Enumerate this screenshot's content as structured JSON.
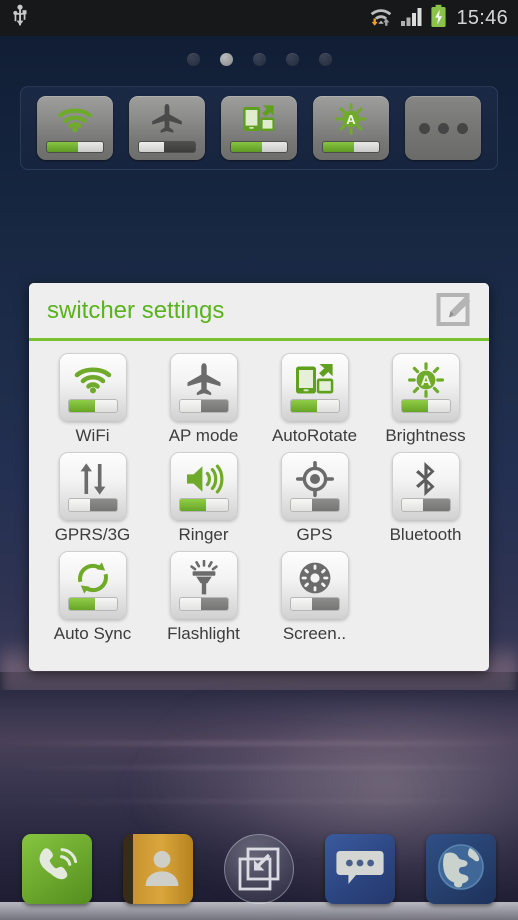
{
  "statusbar": {
    "usb_icon": "usb-icon",
    "wifi_icon": "wifi-transfer-icon",
    "signal_icon": "cellular-signal-icon",
    "battery_icon": "battery-charging-icon",
    "time": "15:46",
    "battery_color": "#8bc34a",
    "text_color": "#d6d6d6"
  },
  "homescreen": {
    "page_dots": {
      "count": 5,
      "active_index": 1
    }
  },
  "widget": {
    "name": "switcher-widget",
    "toggles": [
      {
        "id": "wifi",
        "icon": "wifi-icon",
        "state": "on"
      },
      {
        "id": "ap-mode",
        "icon": "airplane-icon",
        "state": "off"
      },
      {
        "id": "autorotate",
        "icon": "autorotate-icon",
        "state": "on"
      },
      {
        "id": "brightness",
        "icon": "brightness-auto-icon",
        "state": "on"
      }
    ],
    "more_button": {
      "id": "more",
      "icon": "more-dots-icon"
    }
  },
  "dialog": {
    "title": "switcher settings",
    "title_color": "#59b31e",
    "accent_color": "#7ac12f",
    "edit_icon": "edit-pencil-square-icon",
    "items": [
      {
        "label": "WiFi",
        "icon": "wifi-icon",
        "state": "on"
      },
      {
        "label": "AP mode",
        "icon": "airplane-icon",
        "state": "off"
      },
      {
        "label": "AutoRotate",
        "icon": "autorotate-icon",
        "state": "on"
      },
      {
        "label": "Brightness",
        "icon": "brightness-auto-icon",
        "state": "on"
      },
      {
        "label": "GPRS/3G",
        "icon": "data-arrows-icon",
        "state": "off"
      },
      {
        "label": "Ringer",
        "icon": "speaker-icon",
        "state": "on"
      },
      {
        "label": "GPS",
        "icon": "gps-target-icon",
        "state": "off"
      },
      {
        "label": "Bluetooth",
        "icon": "bluetooth-icon",
        "state": "off"
      },
      {
        "label": "Auto Sync",
        "icon": "sync-arrows-icon",
        "state": "on"
      },
      {
        "label": "Flashlight",
        "icon": "flashlight-icon",
        "state": "off"
      },
      {
        "label": "Screen..",
        "icon": "screen-timeout-icon",
        "state": "off"
      }
    ]
  },
  "dock": {
    "items": [
      {
        "id": "phone",
        "icon": "phone-icon"
      },
      {
        "id": "contacts",
        "icon": "contacts-book-icon"
      },
      {
        "id": "drawer",
        "icon": "app-drawer-icon"
      },
      {
        "id": "messaging",
        "icon": "message-bubble-icon"
      },
      {
        "id": "browser",
        "icon": "globe-icon"
      }
    ]
  }
}
